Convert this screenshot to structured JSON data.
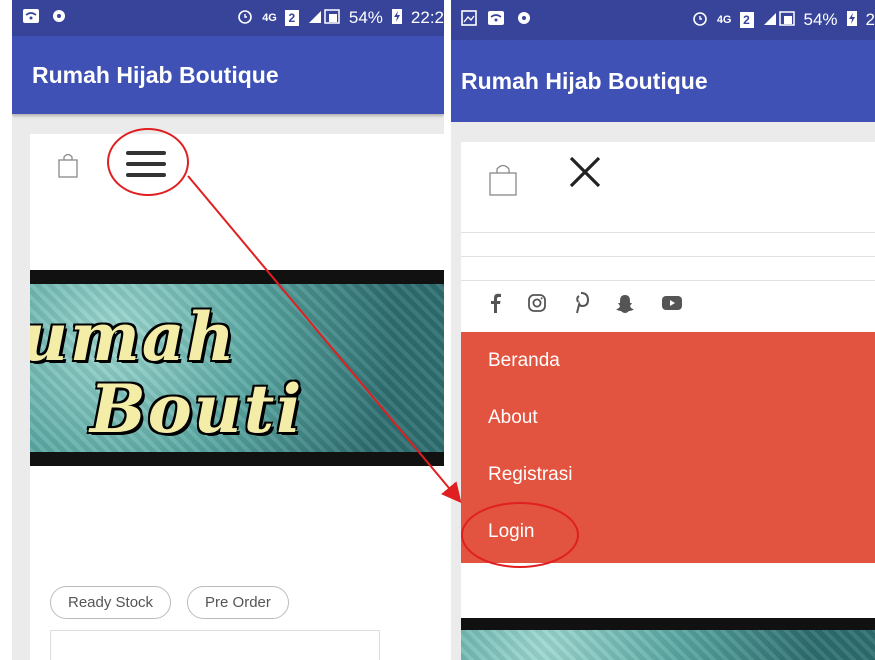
{
  "left_screen": {
    "status": {
      "time": "22:2",
      "battery": "54%",
      "network": "4G"
    },
    "app_title": "Rumah Hijab Boutique",
    "banner_lines": [
      "umah",
      "Bouti"
    ],
    "filters": [
      "Ready Stock",
      "Pre Order"
    ]
  },
  "right_screen": {
    "status": {
      "time": "2",
      "battery": "54%",
      "network": "4G"
    },
    "app_title": "Rumah Hijab Boutique",
    "social_icons": [
      "facebook-icon",
      "instagram-icon",
      "pinterest-icon",
      "snapchat-icon",
      "youtube-icon"
    ],
    "menu": [
      "Beranda",
      "About",
      "Registrasi",
      "Login"
    ]
  },
  "colors": {
    "appbar": "#3f51b5",
    "statusbar": "#37449a",
    "menu_bg": "#e2543f",
    "annotation": "#e02020"
  }
}
